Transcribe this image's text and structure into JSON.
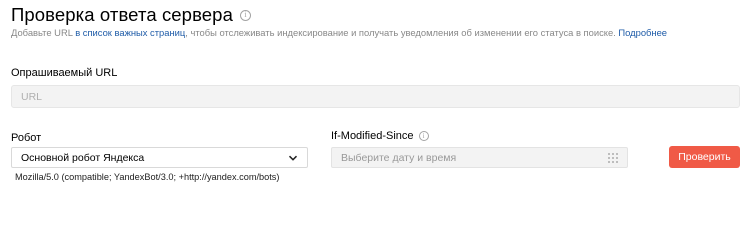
{
  "page": {
    "title": "Проверка ответа сервера",
    "subtitle_before": "Добавьте URL ",
    "subtitle_link": "в список важных страниц",
    "subtitle_middle": ", чтобы отслеживать индексирование и получать уведомления об изменении его статуса в поиске. ",
    "subtitle_more": "Подробнее"
  },
  "url_field": {
    "label": "Опрашиваемый URL",
    "placeholder": "URL",
    "value": ""
  },
  "robot": {
    "label": "Робот",
    "selected": "Основной робот Яндекса",
    "user_agent": "Mozilla/5.0 (compatible; YandexBot/3.0; +http://yandex.com/bots)"
  },
  "if_modified_since": {
    "label": "If-Modified-Since",
    "placeholder": "Выберите дату и время"
  },
  "submit": {
    "label": "Проверить",
    "color": "#f05a46"
  },
  "icons": {
    "title_info": "info-icon",
    "ims_info": "info-icon",
    "select_chevron": "chevron-down-icon",
    "calendar": "calendar-icon"
  }
}
